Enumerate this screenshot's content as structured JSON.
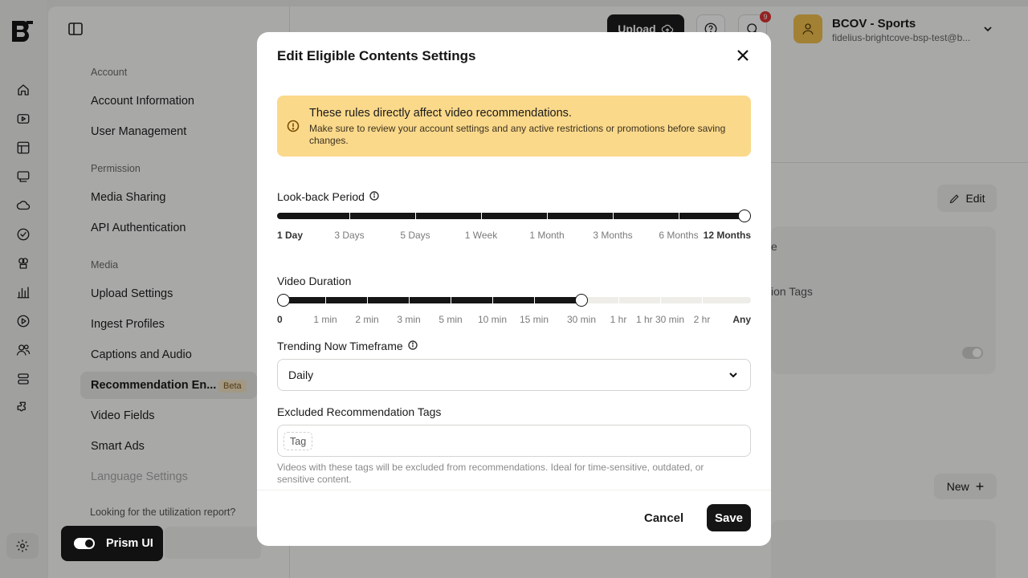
{
  "rail": {
    "icons": [
      "home-icon",
      "video-icon",
      "layout-icon",
      "monitor-icon",
      "cloud-icon",
      "shield-icon",
      "studio-icon",
      "analytics-icon",
      "play-icon",
      "users-icon",
      "database-icon",
      "puzzle-icon"
    ],
    "settings_icon": "gear-icon"
  },
  "settings_nav": {
    "sections": [
      {
        "label": "Account",
        "items": [
          "Account Information",
          "User Management"
        ]
      },
      {
        "label": "Permission",
        "items": [
          "Media Sharing",
          "API Authentication"
        ]
      },
      {
        "label": "Media",
        "items": [
          "Upload Settings",
          "Ingest Profiles",
          "Captions and Audio",
          "Recommendation En...",
          "Video Fields",
          "Smart Ads",
          "Language Settings"
        ]
      }
    ],
    "active_item": "Recommendation En...",
    "beta_badge": "Beta",
    "disabled_item": "Language Settings",
    "utilization_text": "Looking for the utilization report?"
  },
  "topbar": {
    "upload_label": "Upload",
    "notification_count": "9",
    "account_name": "BCOV - Sports",
    "account_email": "fidelius-brightcove-bsp-test@b..."
  },
  "background_content": {
    "edit_label": "Edit",
    "peek_1": "e",
    "peek_2": "ion Tags",
    "new_label": "New"
  },
  "prism_toggle": {
    "label": "Prism UI",
    "enabled": true
  },
  "modal": {
    "title": "Edit Eligible Contents Settings",
    "alert": {
      "title": "These rules directly affect video recommendations.",
      "body": "Make sure to review your account settings and any active restrictions or promotions before saving changes.",
      "color": "#fbd98b"
    },
    "lookback": {
      "label": "Look-back Period",
      "options": [
        "1 Day",
        "3 Days",
        "5 Days",
        "1 Week",
        "1 Month",
        "3 Months",
        "6 Months",
        "12 Months"
      ],
      "range_start": "1 Day",
      "range_end": "12 Months"
    },
    "duration": {
      "label": "Video Duration",
      "options": [
        "0",
        "1 min",
        "2 min",
        "3 min",
        "5 min",
        "10 min",
        "15 min",
        "30 min",
        "1 hr",
        "1 hr 30 min",
        "2 hr",
        "Any"
      ],
      "range_start": "0",
      "range_end": "30 min"
    },
    "trending": {
      "label": "Trending Now Timeframe",
      "value": "Daily"
    },
    "excluded_tags": {
      "label": "Excluded Recommendation Tags",
      "placeholder_chip": "Tag",
      "help": "Videos with these tags will be excluded from recommendations. Ideal for time-sensitive, outdated, or sensitive content."
    },
    "footer": {
      "cancel_label": "Cancel",
      "save_label": "Save"
    }
  }
}
